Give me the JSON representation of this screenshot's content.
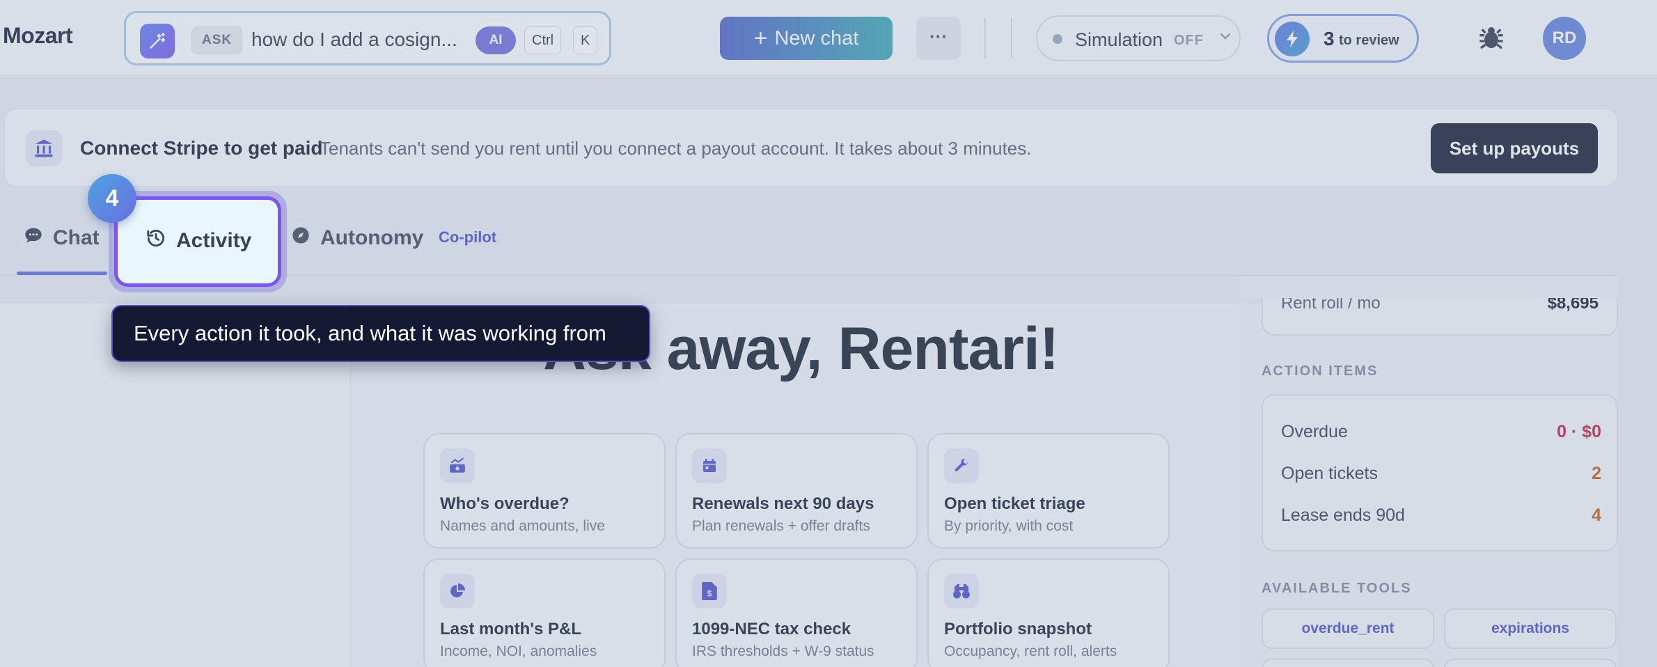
{
  "app": {
    "name": "Mozart"
  },
  "askbar": {
    "chip": "ASK",
    "query": "how do I add a cosign...",
    "ai_chip": "AI",
    "keys": [
      "Ctrl",
      "K"
    ]
  },
  "header": {
    "new_chat": "New chat",
    "more": "···",
    "simulation": {
      "label": "Simulation",
      "state": "OFF"
    },
    "review": {
      "count": "3",
      "label": "to review"
    },
    "avatar": "RD"
  },
  "banner": {
    "title": "Connect Stripe to get paid",
    "text": "Tenants can't send you rent until you connect a payout account. It takes about 3 minutes.",
    "button": "Set up payouts"
  },
  "tabs": {
    "chat": "Chat",
    "activity": "Activity",
    "autonomy": "Autonomy",
    "mode": "Co-pilot"
  },
  "hero": {
    "title": "Ask away, Rentari!"
  },
  "cards": [
    {
      "title": "Who's overdue?",
      "subtitle": "Names and amounts, live",
      "icon": "money-chart-icon"
    },
    {
      "title": "Renewals next 90 days",
      "subtitle": "Plan renewals + offer drafts",
      "icon": "calendar-icon"
    },
    {
      "title": "Open ticket triage",
      "subtitle": "By priority, with cost",
      "icon": "wrench-icon"
    },
    {
      "title": "Last month's P&L",
      "subtitle": "Income, NOI, anomalies",
      "icon": "pie-chart-icon"
    },
    {
      "title": "1099-NEC tax check",
      "subtitle": "IRS thresholds + W-9 status",
      "icon": "tax-document-icon"
    },
    {
      "title": "Portfolio snapshot",
      "subtitle": "Occupancy, rent roll, alerts",
      "icon": "binoculars-icon"
    }
  ],
  "right": {
    "rent_roll": {
      "label": "Rent roll / mo",
      "value": "$8,695"
    },
    "action_items_heading": "ACTION ITEMS",
    "action_items": [
      {
        "label": "Overdue",
        "value": "0 · $0",
        "color": "#c2183c"
      },
      {
        "label": "Open tickets",
        "value": "2",
        "color": "#c25a12"
      },
      {
        "label": "Lease ends 90d",
        "value": "4",
        "color": "#c25a12"
      }
    ],
    "tools_heading": "AVAILABLE TOOLS",
    "tools": [
      "overdue_rent",
      "expirations"
    ]
  },
  "tour": {
    "step": "4",
    "tooltip": "Every action it took, and what it was working from"
  }
}
